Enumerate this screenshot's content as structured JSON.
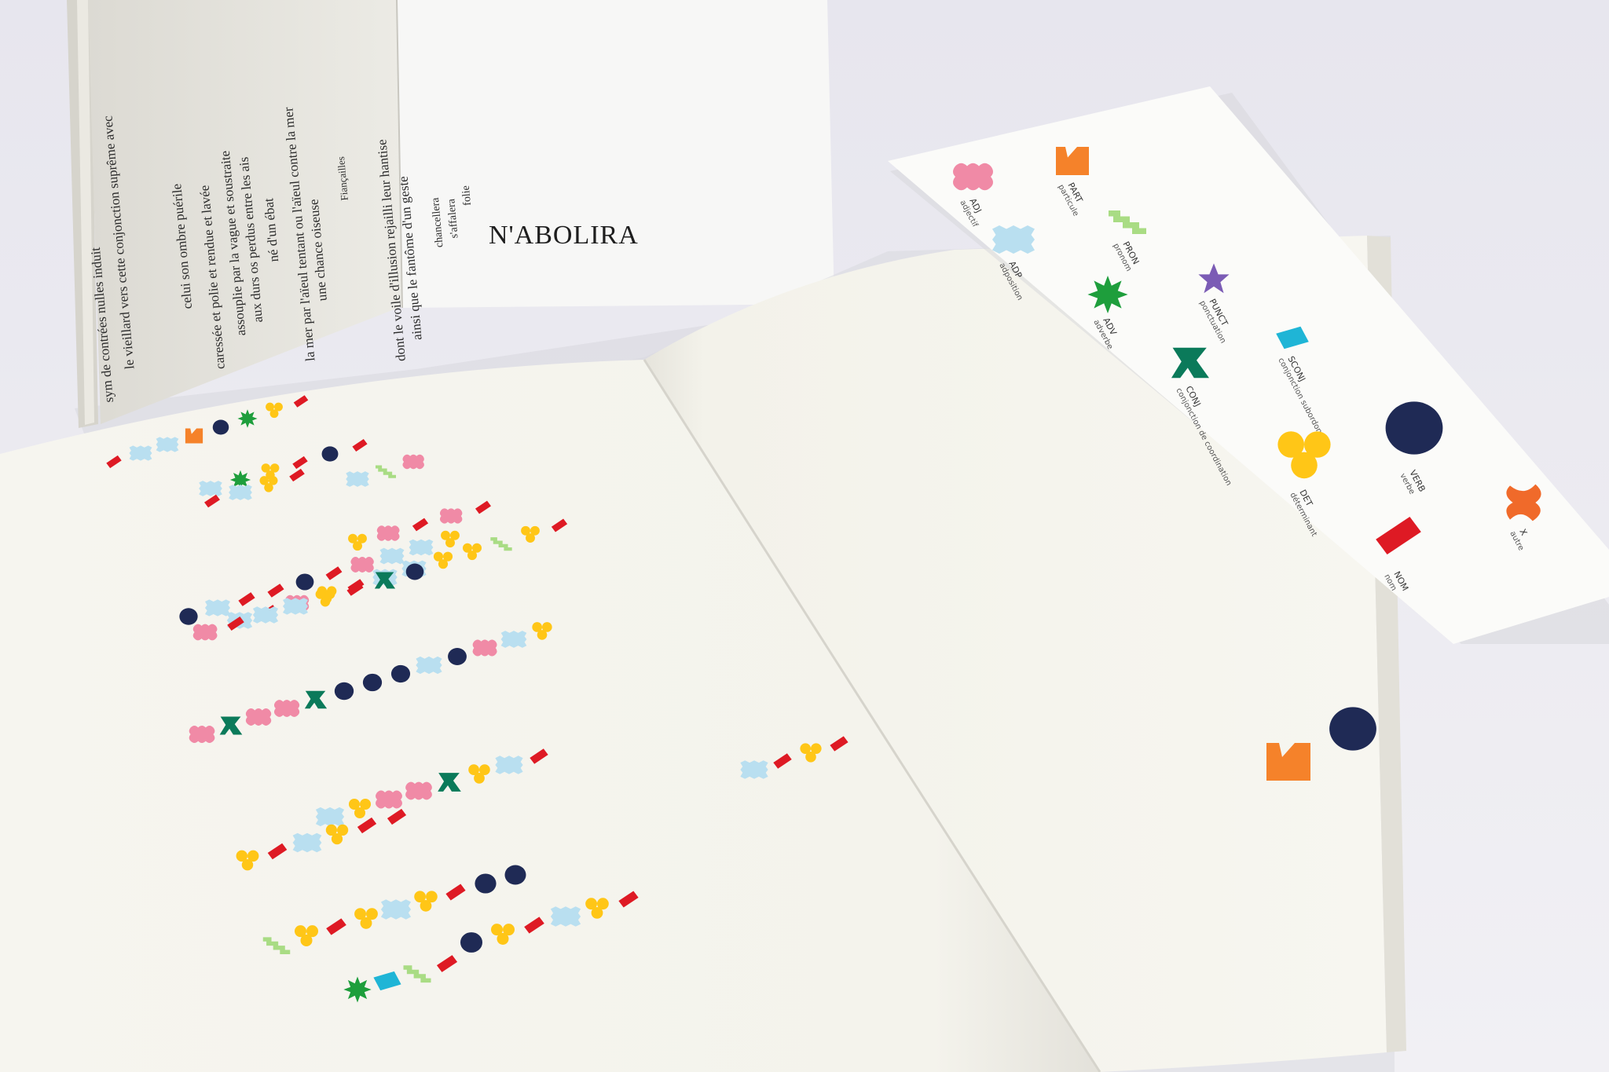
{
  "back_booklet": {
    "title": "N'ABOLIRA",
    "poem_lines": [
      "sym de contrées nulles induit",
      "le vieillard vers cette conjonction suprême avec",
      "celui son ombre puérile",
      "caressée et polie et rendue et lavée",
      "assouplie par la vague et soustraite",
      "aux durs os perdus entre les ais",
      "né d'un ébat",
      "la mer par l'aïeul tentant ou l'aïeul contre la mer",
      "une chance oiseuse",
      "Fiançailles",
      "dont le voile d'illusion rejailli leur hantise",
      "ainsi que le fantôme d'un geste",
      "chancellera",
      "s'affalera",
      "folie"
    ]
  },
  "legend": {
    "items": [
      {
        "code": "ADJ",
        "label": "adjectif",
        "color": "#f08aa6"
      },
      {
        "code": "PART",
        "label": "particule",
        "color": "#f5822a"
      },
      {
        "code": "ADP",
        "label": "adposition",
        "color": "#b9dff0"
      },
      {
        "code": "PRON",
        "label": "pronom",
        "color": "#a9dc84"
      },
      {
        "code": "ADV",
        "label": "adverbe",
        "color": "#1e9e3c"
      },
      {
        "code": "PUNCT",
        "label": "ponctuation",
        "color": "#7b5cb5"
      },
      {
        "code": "CONJ",
        "label": "conjonction de coordination",
        "color": "#0b7a5a"
      },
      {
        "code": "SCONJ",
        "label": "conjonction subordonnée",
        "color": "#1fb5d6"
      },
      {
        "code": "DET",
        "label": "déterminant",
        "color": "#ffc617"
      },
      {
        "code": "VERB",
        "label": "verbe",
        "color": "#1f2a55"
      },
      {
        "code": "NOM",
        "label": "nom",
        "color": "#de1a24"
      },
      {
        "code": "X",
        "label": "autre",
        "color": "#f06a2a"
      }
    ]
  },
  "colors": {
    "NOM": "#de1a24",
    "VERB": "#1f2a55",
    "DET": "#ffc617",
    "ADJ": "#f08aa6",
    "ADP": "#b9dff0",
    "PRON": "#a9dc84",
    "ADV": "#1e9e3c",
    "CONJ": "#0b7a5a",
    "SCONJ": "#1fb5d6",
    "PART": "#f5822a",
    "PUNCT": "#7b5cb5",
    "X": "#f06a2a"
  },
  "glyph_rows": [
    [
      "NOM",
      "ADP",
      "ADP",
      "PART",
      "VERB",
      "ADV",
      "DET",
      "NOM"
    ],
    [
      "ADP",
      "ADV",
      "DET",
      "NOM",
      "VERB",
      "NOM"
    ],
    [
      "NOM",
      "ADP",
      "DET",
      "NOM"
    ],
    [
      "ADP",
      "PRON",
      "ADJ"
    ],
    [
      "DET",
      "ADJ",
      "NOM",
      "ADJ",
      "NOM"
    ],
    [
      "VERB",
      "ADP",
      "NOM",
      "NOM",
      "VERB",
      "NOM",
      "ADJ",
      "ADP",
      "ADP",
      "DET"
    ],
    [
      "ADP",
      "NOM",
      "ADJ",
      "DET",
      "NOM",
      "ADP",
      "ADP",
      "DET",
      "DET",
      "PRON",
      "DET",
      "NOM"
    ],
    [
      "ADJ",
      "NOM",
      "ADP",
      "ADP",
      "DET",
      "NOM",
      "CONJ",
      "VERB"
    ],
    [
      "ADJ",
      "CONJ",
      "ADJ",
      "ADJ",
      "CONJ",
      "VERB",
      "VERB",
      "VERB",
      "ADP",
      "VERB",
      "ADJ",
      "ADP",
      "DET"
    ],
    [
      "ADP",
      "NOM",
      "DET",
      "NOM"
    ],
    [
      "ADP",
      "DET",
      "ADJ",
      "ADJ",
      "CONJ",
      "DET",
      "ADP",
      "NOM"
    ],
    [
      "DET",
      "NOM",
      "ADP",
      "DET",
      "NOM",
      "NOM"
    ],
    [
      "VERB",
      "DET",
      "NOM",
      "ADP",
      "DET",
      "NOM"
    ],
    [
      "PRON",
      "DET",
      "NOM",
      "DET",
      "ADP",
      "DET",
      "NOM",
      "VERB",
      "VERB"
    ],
    [
      "ADV",
      "SCONJ",
      "PRON",
      "NOM"
    ]
  ],
  "right_page_glyphs": [
    "PART",
    "VERB"
  ]
}
